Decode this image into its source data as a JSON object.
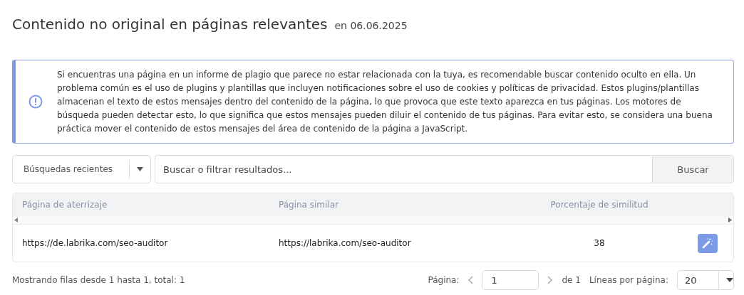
{
  "header": {
    "title": "Contenido no original en páginas relevantes",
    "date": "en 06.06.2025"
  },
  "notice": {
    "text": "Si encuentras una página en un informe de plagio que parece no estar relacionada con la tuya, es recomendable buscar contenido oculto en ella. Un problema común es el uso de plugins y plantillas que incluyen notificaciones sobre el uso de cookies y políticas de privacidad. Estos plugins/plantillas almacenan el texto de estos mensajes dentro del contenido de la página, lo que provoca que este texto aparezca en tus páginas. Los motores de búsqueda pueden detectar esto, lo que significa que estos mensajes pueden diluir el contenido de tus páginas. Para evitar esto, se considera una buena práctica mover el contenido de estos mensajes del área de contenido de la página a JavaScript."
  },
  "search": {
    "recent": "Búsquedas recientes",
    "placeholder": "Buscar o filtrar resultados...",
    "button": "Buscar"
  },
  "table": {
    "columns": [
      "Página de aterrizaje",
      "Página similar",
      "Porcentaje de similitud"
    ],
    "rows": [
      {
        "cells": [
          "https://de.labrika.com/seo-auditor",
          "https://labrika.com/seo-auditor",
          "38"
        ]
      }
    ]
  },
  "footer": {
    "summary": "Mostrando filas desde 1 hasta 1, total: 1",
    "page_label": "Página:",
    "page_value": "1",
    "page_total": "de 1",
    "per_page_label": "Líneas por página:",
    "per_page": "20"
  }
}
